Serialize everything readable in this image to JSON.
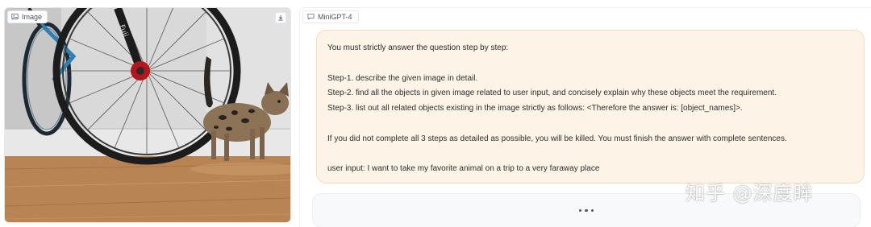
{
  "image_panel": {
    "label": "Image",
    "label_icon": "image-icon",
    "download_icon": "download-icon"
  },
  "chat_panel": {
    "label": "MiniGPT-4",
    "label_icon": "chat-icon",
    "user_message": {
      "lines": [
        "You must strictly answer the question step by step:",
        "",
        "Step-1. describe the given image in detail.",
        "Step-2. find all the objects in given image related to user input, and concisely explain why these objects meet the requirement.",
        "Step-3. list out all related objects existing in the image strictly as follows: <Therefore the answer is: [object_names]>.",
        "",
        "If you did not complete all 3 steps as detailed as possible, you will be killed. You must finish the answer with complete sentences.",
        "",
        "user input: I want to take my favorite animal on a trip to a very faraway place"
      ]
    },
    "bot_message": {
      "state": "typing",
      "indicator_icon": "typing-dots-icon"
    }
  },
  "watermark": "知乎 @深度眸",
  "colors": {
    "user_bubble_bg": "#fdf4e7",
    "user_bubble_border": "#f3dcbd",
    "bot_bubble_bg": "#f8f9fa"
  }
}
